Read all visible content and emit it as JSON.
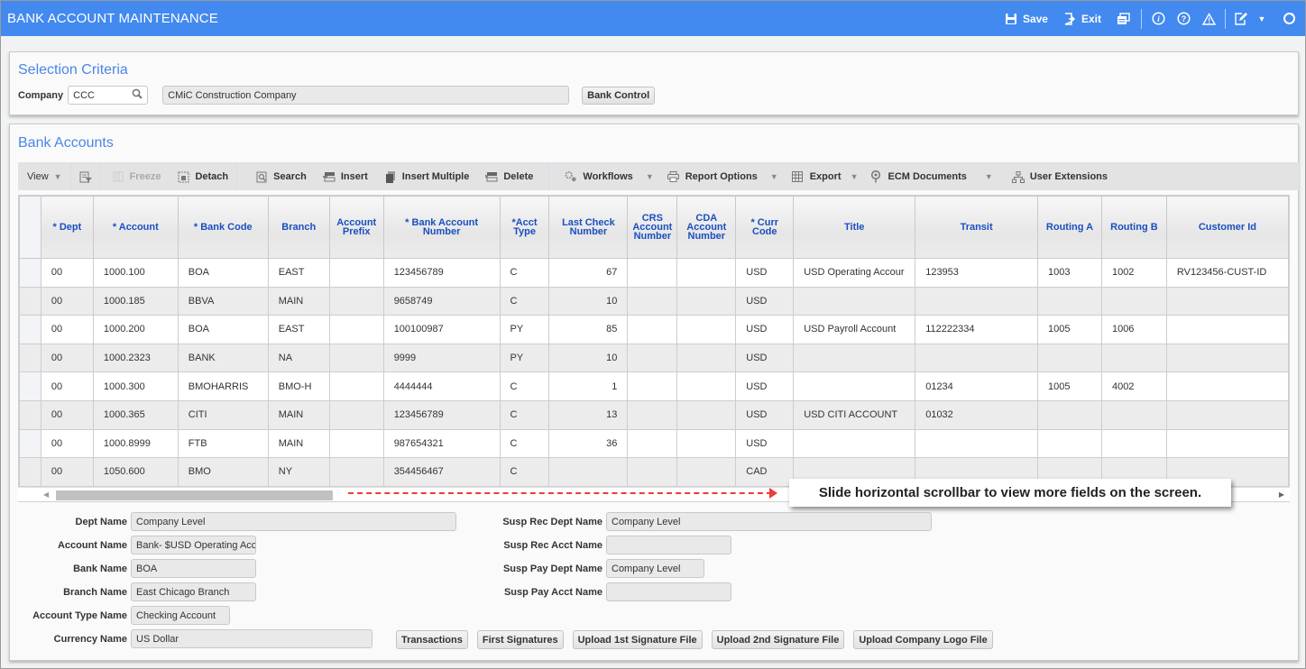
{
  "window": {
    "title": "BANK ACCOUNT MAINTENANCE",
    "actions": [
      {
        "label": "Save",
        "icon": "save-icon"
      },
      {
        "label": "Exit",
        "icon": "exit-icon"
      }
    ],
    "icon_buttons": [
      "windows-icon",
      "info-icon",
      "help-icon",
      "warning-icon",
      "edit-icon",
      "dropdown-icon",
      "refresh-icon"
    ]
  },
  "selection": {
    "title": "Selection Criteria",
    "company_label": "Company",
    "company_value": "CCC",
    "company_name": "CMiC Construction Company",
    "bank_control_label": "Bank Control"
  },
  "bank_accounts": {
    "title": "Bank Accounts",
    "toolbar": {
      "view": "View",
      "freeze": "Freeze",
      "detach": "Detach",
      "search": "Search",
      "insert": "Insert",
      "insert_multiple": "Insert Multiple",
      "delete": "Delete",
      "workflows": "Workflows",
      "report_options": "Report Options",
      "export": "Export",
      "ecm_documents": "ECM Documents",
      "user_extensions": "User Extensions"
    },
    "columns": [
      "* Dept",
      "* Account",
      "* Bank Code",
      "Branch",
      "Account Prefix",
      "* Bank Account Number",
      "*Acct Type",
      "Last Check Number",
      "CRS Account Number",
      "CDA Account Number",
      "* Curr Code",
      "Title",
      "Transit",
      "Routing A",
      "Routing B",
      "Customer Id"
    ],
    "rows": [
      [
        "00",
        "1000.100",
        "BOA",
        "EAST",
        "",
        "123456789",
        "C",
        "67",
        "",
        "",
        "USD",
        "USD Operating Accour",
        "123953",
        "1003",
        "1002",
        "RV123456-CUST-ID"
      ],
      [
        "00",
        "1000.185",
        "BBVA",
        "MAIN",
        "",
        "9658749",
        "C",
        "10",
        "",
        "",
        "USD",
        "",
        "",
        "",
        "",
        ""
      ],
      [
        "00",
        "1000.200",
        "BOA",
        "EAST",
        "",
        "100100987",
        "PY",
        "85",
        "",
        "",
        "USD",
        "USD Payroll Account",
        "112222334",
        "1005",
        "1006",
        ""
      ],
      [
        "00",
        "1000.2323",
        "BANK",
        "NA",
        "",
        "9999",
        "PY",
        "10",
        "",
        "",
        "USD",
        "",
        "",
        "",
        "",
        ""
      ],
      [
        "00",
        "1000.300",
        "BMOHARRIS",
        "BMO-H",
        "",
        "4444444",
        "C",
        "1",
        "",
        "",
        "USD",
        "",
        "01234",
        "1005",
        "4002",
        ""
      ],
      [
        "00",
        "1000.365",
        "CITI",
        "MAIN",
        "",
        "123456789",
        "C",
        "13",
        "",
        "",
        "USD",
        "USD CITI ACCOUNT",
        "01032",
        "",
        "",
        ""
      ],
      [
        "00",
        "1000.8999",
        "FTB",
        "MAIN",
        "",
        "987654321",
        "C",
        "36",
        "",
        "",
        "USD",
        "",
        "",
        "",
        "",
        ""
      ],
      [
        "00",
        "1050.600",
        "BMO",
        "NY",
        "",
        "354456467",
        "C",
        "",
        "",
        "",
        "CAD",
        "",
        "",
        "",
        "",
        ""
      ]
    ],
    "callout": "Slide horizontal scrollbar to view more fields on the screen."
  },
  "details": {
    "left": [
      {
        "label": "Dept Name",
        "value": "Company Level"
      },
      {
        "label": "Account Name",
        "value": "Bank- $USD Operating Acc"
      },
      {
        "label": "Bank Name",
        "value": "BOA"
      },
      {
        "label": "Branch Name",
        "value": "East Chicago Branch"
      },
      {
        "label": "Account Type Name",
        "value": "Checking Account"
      },
      {
        "label": "Currency Name",
        "value": "US Dollar"
      }
    ],
    "right": [
      {
        "label": "Susp Rec Dept Name",
        "value": "Company Level"
      },
      {
        "label": "Susp Rec Acct Name",
        "value": ""
      },
      {
        "label": "Susp Pay Dept Name",
        "value": "Company Level"
      },
      {
        "label": "Susp Pay Acct Name",
        "value": ""
      }
    ],
    "buttons": [
      "Transactions",
      "First Signatures",
      "Upload 1st Signature File",
      "Upload 2nd Signature File",
      "Upload Company Logo File"
    ]
  },
  "colors": {
    "titlebar": "#4289f0",
    "section_title": "#4a86e8",
    "column_header_text": "#1a4fc0",
    "callout_arrow": "#ee3b3b"
  }
}
